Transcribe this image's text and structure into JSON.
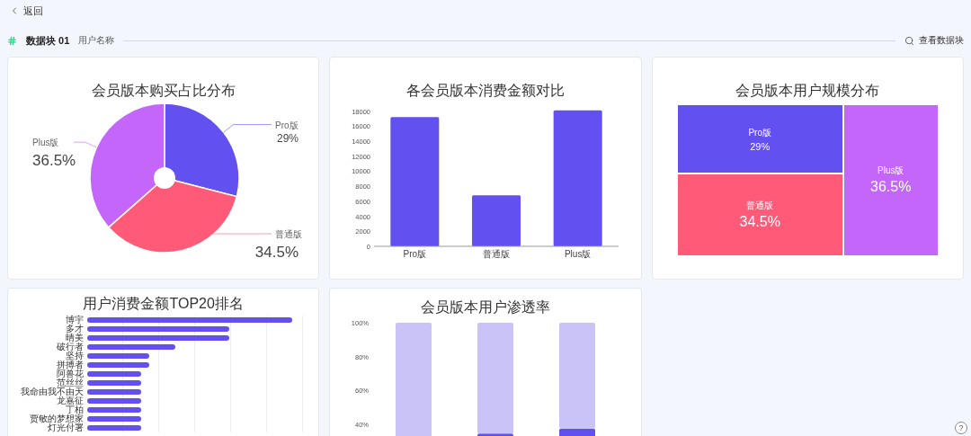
{
  "back": {
    "label": "返回"
  },
  "header": {
    "title": "数据块 01",
    "subtitle": "用户名称",
    "action": "查看数据块"
  },
  "pie_card": {
    "title": "会员版本购买占比分布",
    "chart_data": {
      "type": "pie",
      "categories": [
        "Pro版",
        "普通版",
        "Plus版"
      ],
      "series": [
        {
          "colors": [
            "#6350f0",
            "#ff5a78",
            "#c466fa"
          ],
          "values": [
            29,
            34.5,
            36.5
          ]
        }
      ],
      "value_labels": [
        "29%",
        "34.5%",
        "36.5%"
      ]
    }
  },
  "bar_card": {
    "title": "各会员版本消费金额对比",
    "chart_data": {
      "type": "bar",
      "categories": [
        "Pro版",
        "普通版",
        "Plus版"
      ],
      "series": [
        {
          "color": "#6350f0",
          "values": [
            17200,
            6800,
            18100
          ]
        }
      ],
      "ylim": [
        0,
        18200
      ],
      "yticks": [
        0,
        2000,
        4000,
        6000,
        8000,
        10000,
        12000,
        14000,
        16000,
        18000
      ]
    }
  },
  "treemap_card": {
    "title": "会员版本用户规模分布",
    "tiles": [
      {
        "name": "Pro版",
        "percent": "29%",
        "color": "#6350f0"
      },
      {
        "name": "普通版",
        "percent": "34.5%",
        "color": "#ff5a78"
      },
      {
        "name": "Plus版",
        "percent": "36.5%",
        "color": "#c466fa"
      }
    ]
  },
  "ranking_card": {
    "title": "用户消费金额TOP20排名",
    "rows": [
      {
        "name": "博宇",
        "level": 0.95
      },
      {
        "name": "多才",
        "level": 0.66
      },
      {
        "name": "晴美",
        "level": 0.66
      },
      {
        "name": "破行者",
        "level": 0.41
      },
      {
        "name": "坚持",
        "level": 0.29
      },
      {
        "name": "拼搏者",
        "level": 0.29
      },
      {
        "name": "阿兽花",
        "level": 0.25
      },
      {
        "name": "范丝丝",
        "level": 0.25
      },
      {
        "name": "我命由我不由天",
        "level": 0.25
      },
      {
        "name": "龙嘉征",
        "level": 0.25
      },
      {
        "name": "丁柏",
        "level": 0.25
      },
      {
        "name": "贾敏的梦想家",
        "level": 0.25
      },
      {
        "name": "灯光付署",
        "level": 0.25
      }
    ]
  },
  "penetration_card": {
    "title": "会员版本用户渗透率",
    "chart_data": {
      "type": "bar",
      "series": [
        {
          "color": "#6350f0",
          "values": [
            null,
            34.5,
            37.5
          ]
        },
        {
          "color": "#c9c3f7",
          "values": [
            100,
            65.5,
            62.5
          ]
        }
      ],
      "stacked": true,
      "ylim": [
        32,
        100
      ],
      "yticks": [
        {
          "value": 40,
          "label": "40%"
        },
        {
          "value": 60,
          "label": "60%"
        },
        {
          "value": 80,
          "label": "80%"
        },
        {
          "value": 100,
          "label": "100%"
        }
      ]
    }
  },
  "help": {
    "label": "?"
  }
}
